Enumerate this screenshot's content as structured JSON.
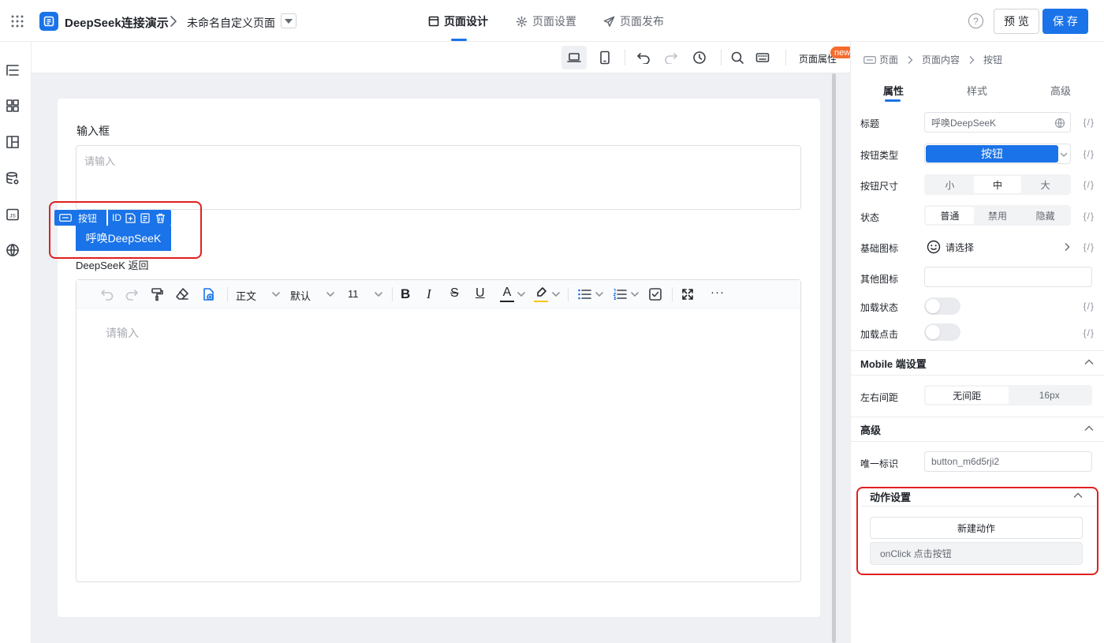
{
  "app": {
    "title": "DeepSeek连接演示",
    "page_name": "未命名自定义页面"
  },
  "top_tabs": [
    {
      "label": "页面设计"
    },
    {
      "label": "页面设置"
    },
    {
      "label": "页面发布"
    }
  ],
  "top_actions": {
    "preview": "预 览",
    "save": "保 存",
    "help": "?"
  },
  "toolbar": {
    "page_props": "页面属性",
    "new_badge": "new"
  },
  "canvas": {
    "input_label": "输入框",
    "input_placeholder": "请输入",
    "widget_tag": "按钮",
    "widget_id": "ID",
    "button_label": "呼唤DeepSeeK",
    "editor_label": "DeepSeeK 返回",
    "editor_placeholder": "请输入",
    "editor_toolbar": {
      "style": "正文",
      "font": "默认",
      "size": "11",
      "more": "···"
    }
  },
  "panel": {
    "breadcrumb": [
      "页面",
      "页面内容",
      "按钮"
    ],
    "tabs": [
      "属性",
      "样式",
      "高级"
    ],
    "expr": "{/}",
    "rows": {
      "title_label": "标题",
      "title_value": "呼唤DeepSeeK",
      "type_label": "按钮类型",
      "type_value": "按钮",
      "size_label": "按钮尺寸",
      "size_options": [
        "小",
        "中",
        "大"
      ],
      "state_label": "状态",
      "state_options": [
        "普通",
        "禁用",
        "隐藏"
      ],
      "icon_label": "基础图标",
      "icon_value": "请选择",
      "other_icon_label": "其他图标",
      "loading_label": "加载状态",
      "loading_click_label": "加载点击"
    },
    "mobile": {
      "title": "Mobile 端设置",
      "padding_label": "左右间距",
      "padding_options": [
        "无间距",
        "16px"
      ]
    },
    "advanced": {
      "title": "高级",
      "uid_label": "唯一标识",
      "uid_value": "button_m6d5rji2"
    },
    "actions": {
      "title": "动作设置",
      "new_action": "新建动作",
      "item": "onClick 点击按钮"
    }
  },
  "colors": {
    "primary": "#1a73e8",
    "highlight": "#e02020"
  }
}
